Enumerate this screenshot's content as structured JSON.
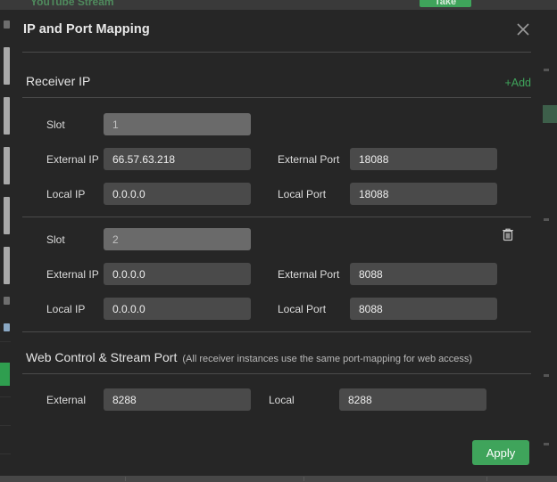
{
  "background": {
    "tab_label": "YouTube Stream",
    "take_button": "Take",
    "accent_color": "#3fa45b"
  },
  "modal": {
    "title": "IP and Port Mapping",
    "close_icon": "close-icon",
    "apply_label": "Apply"
  },
  "receiver_section": {
    "heading": "Receiver IP",
    "add_label": "+Add",
    "delete_icon": "trash-icon",
    "slots": [
      {
        "slot_label": "Slot",
        "slot_value": "1",
        "external_ip_label": "External IP",
        "external_ip_value": "66.57.63.218",
        "external_port_label": "External Port",
        "external_port_value": "18088",
        "local_ip_label": "Local IP",
        "local_ip_value": "0.0.0.0",
        "local_port_label": "Local Port",
        "local_port_value": "18088",
        "deletable": false
      },
      {
        "slot_label": "Slot",
        "slot_value": "2",
        "external_ip_label": "External IP",
        "external_ip_value": "0.0.0.0",
        "external_port_label": "External Port",
        "external_port_value": "8088",
        "local_ip_label": "Local IP",
        "local_ip_value": "0.0.0.0",
        "local_port_label": "Local Port",
        "local_port_value": "8088",
        "deletable": true
      }
    ]
  },
  "web_control_section": {
    "heading": "Web Control & Stream Port",
    "note": "(All receiver instances use the same port-mapping for web access)",
    "external_label": "External",
    "external_value": "8288",
    "local_label": "Local",
    "local_value": "8288"
  }
}
